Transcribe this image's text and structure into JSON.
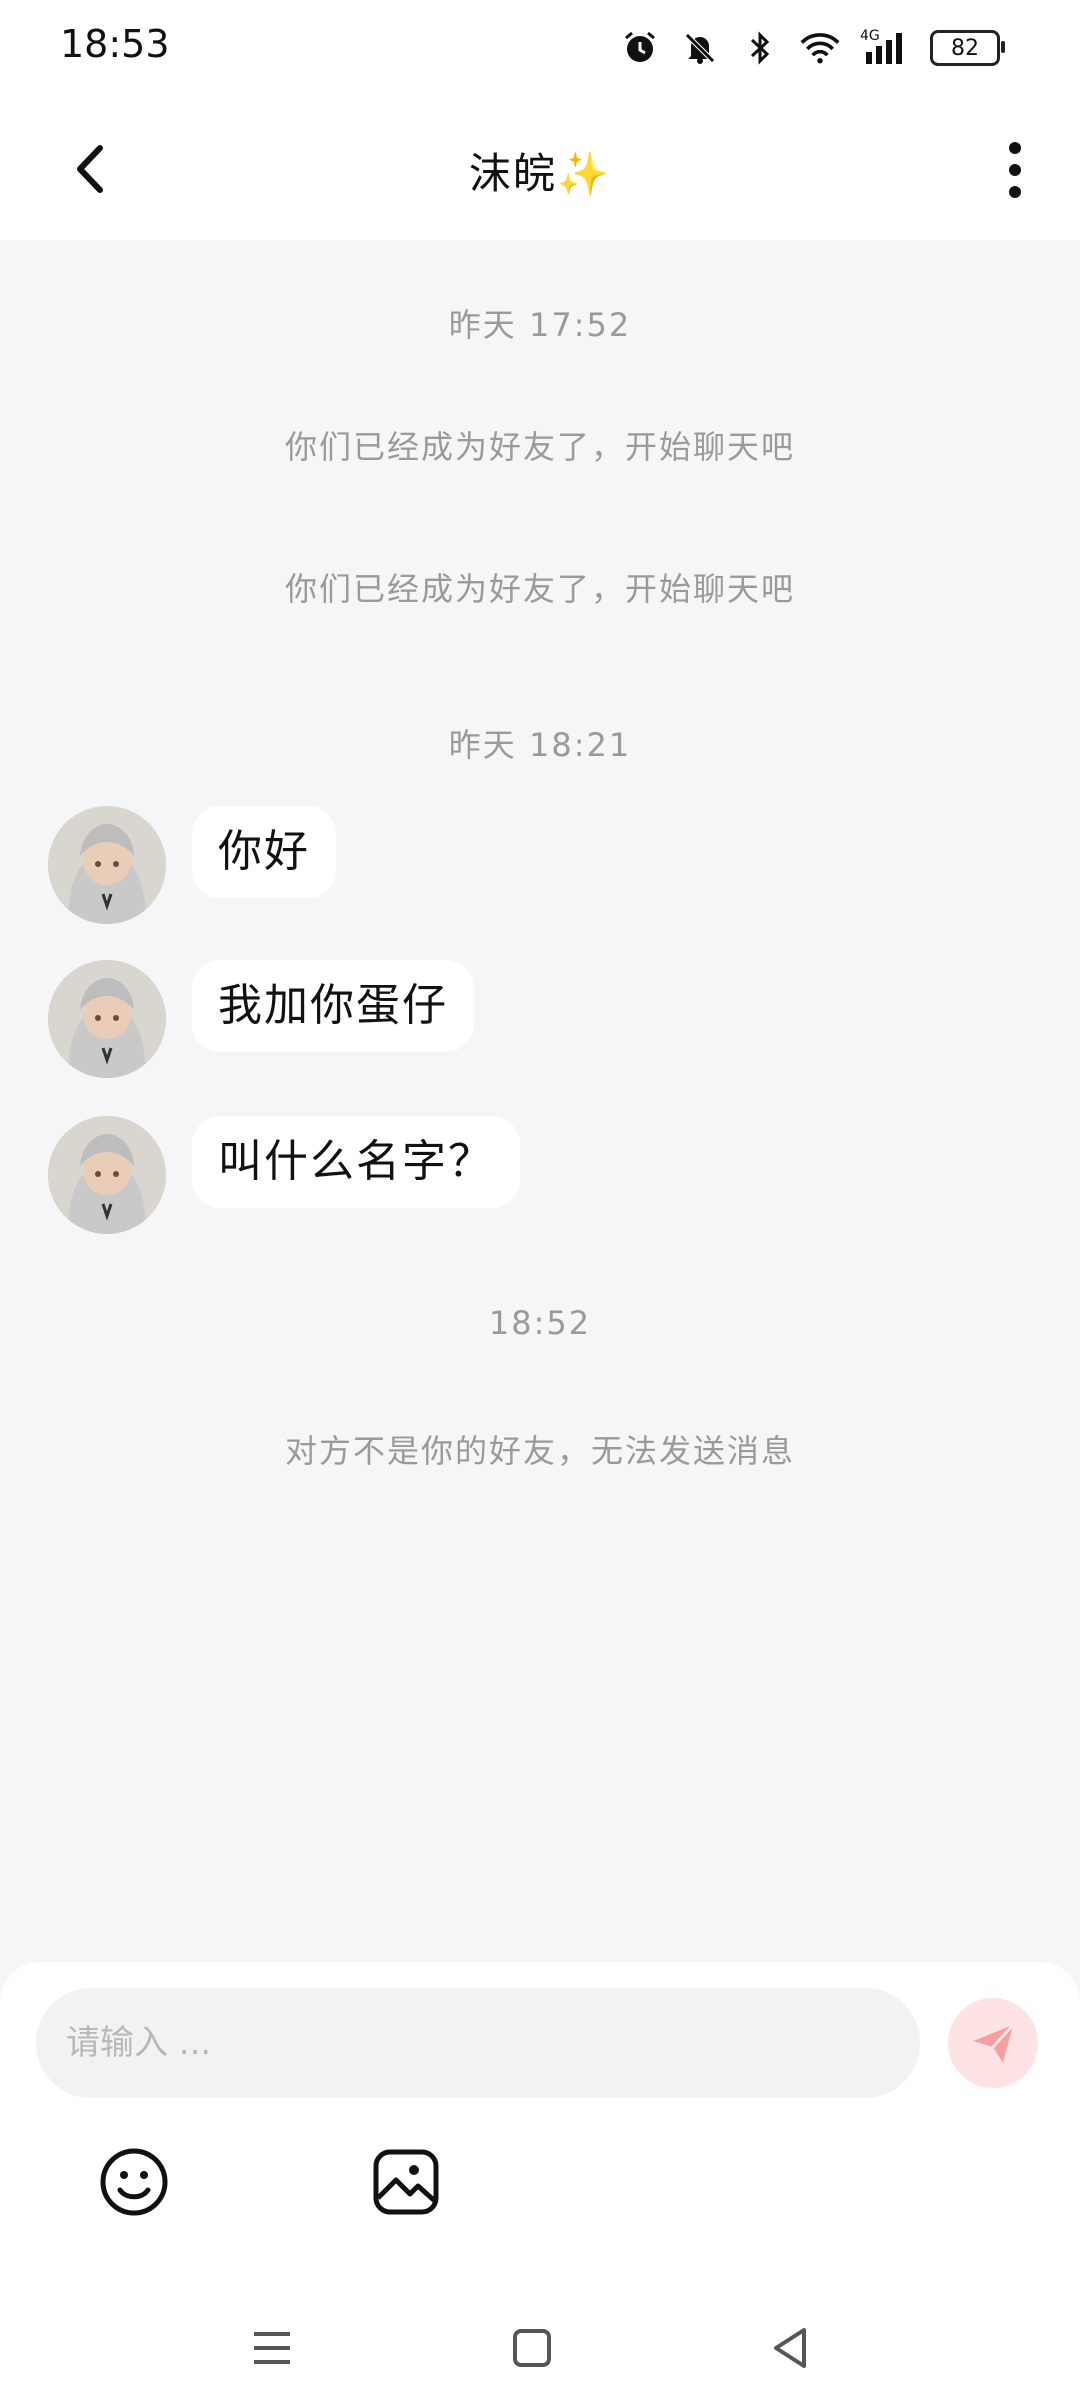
{
  "status_bar": {
    "time": "18:53",
    "network_label": "4G",
    "battery": "82"
  },
  "header": {
    "title": "沫皖✨"
  },
  "messages": {
    "system": [
      {
        "text": "昨天 17:52"
      },
      {
        "text": "你们已经成为好友了，开始聊天吧"
      },
      {
        "text": "你们已经成为好友了，开始聊天吧"
      },
      {
        "text": "昨天 18:21"
      },
      {
        "text": "18:52"
      },
      {
        "text": "对方不是你的好友，无法发送消息"
      }
    ],
    "incoming": [
      {
        "text": "你好"
      },
      {
        "text": "我加你蛋仔"
      },
      {
        "text": "叫什么名字？"
      }
    ]
  },
  "input": {
    "placeholder": "请输入 ..."
  },
  "colors": {
    "send_button_bg": "#fde3e3",
    "send_icon": "#f4a0a0",
    "background": "#f5f6f8"
  }
}
